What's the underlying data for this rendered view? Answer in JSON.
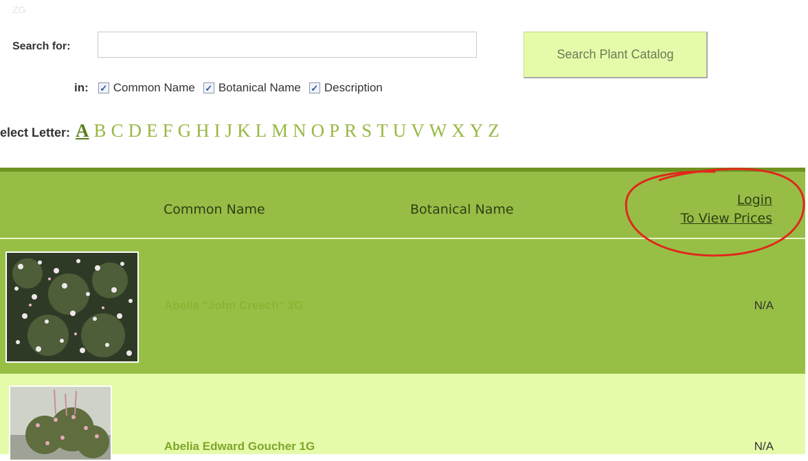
{
  "faint_text": "ZG",
  "search": {
    "label": "Search for:",
    "value": "",
    "placeholder": "",
    "button_label": "Search Plant Catalog",
    "in_label": "in:",
    "fields": [
      {
        "label": "Common Name",
        "checked": true
      },
      {
        "label": "Botanical Name",
        "checked": true
      },
      {
        "label": "Description",
        "checked": true
      }
    ]
  },
  "letters": {
    "label": "elect Letter:",
    "items": [
      "A",
      "B",
      "C",
      "D",
      "E",
      "F",
      "G",
      "H",
      "I",
      "J",
      "K",
      "L",
      "M",
      "N",
      "O",
      "P",
      "R",
      "S",
      "T",
      "U",
      "V",
      "W",
      "X",
      "Y",
      "Z"
    ],
    "active": "A"
  },
  "table": {
    "headers": {
      "common_name": "Common Name",
      "botanical_name": "Botanical Name",
      "login_line1": "Login",
      "login_line2": "To View Prices"
    },
    "rows": [
      {
        "common_name": "Abelia \"John Creech\" 3G",
        "botanical_name": "",
        "price": "N/A"
      },
      {
        "common_name": "Abelia Edward Goucher 1G",
        "botanical_name": "",
        "price": "N/A"
      }
    ]
  },
  "colors": {
    "header_green": "#97bd46",
    "row_green": "#98bf45",
    "row_light": "#e5fbaa",
    "link_green": "#98b843",
    "annotation_red": "#e0281c"
  }
}
